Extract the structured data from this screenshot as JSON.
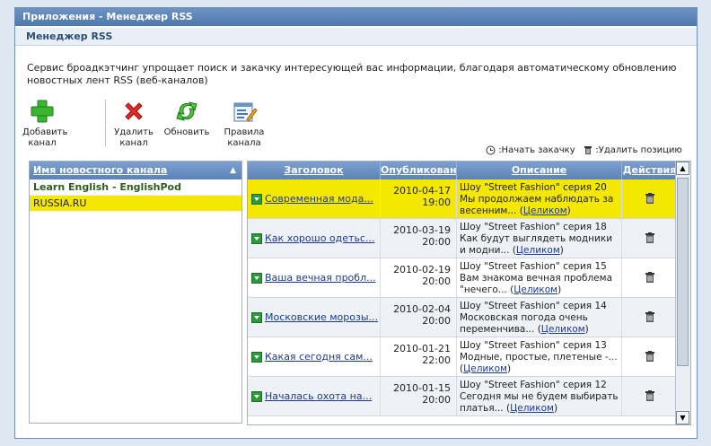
{
  "window": {
    "title": "Приложения - Менеджер RSS",
    "subheader": "Менеджер RSS",
    "description": "Сервис броадкэтчинг упрощает поиск и закачку интересующей вас информации, благодаря автоматическому обновлению новостных лент RSS (веб-каналов)"
  },
  "toolbar": {
    "add_line1": "Добавить",
    "add_line2": "канал",
    "delete_line1": "Удалить",
    "delete_line2": "канал",
    "refresh": "Обновить",
    "rules_line1": "Правила",
    "rules_line2": "канала"
  },
  "legend": {
    "start_download": ":Начать закачку",
    "delete_item": ":Удалить позицию"
  },
  "feeds": {
    "header": "Имя новостного канала",
    "items": [
      {
        "name": "Learn English - EnglishPod"
      },
      {
        "name": "RUSSIA.RU"
      }
    ]
  },
  "table": {
    "headers": [
      "Заголовок",
      "Опубликован",
      "Описание",
      "Действия"
    ],
    "rows": [
      {
        "title": "Современная мода...",
        "date": "2010-04-17",
        "time": "19:00",
        "desc": "Шоу \"Street Fashion\" серия 20 Мы продолжаем наблюдать за весенним...",
        "link": "Целиком"
      },
      {
        "title": "Как хорошо одетьс...",
        "date": "2010-03-19",
        "time": "20:00",
        "desc": "Шоу \"Street Fashion\" серия 18 Как будут выглядеть модники и модни...",
        "link": "Целиком"
      },
      {
        "title": "Ваша вечная пробл...",
        "date": "2010-02-19",
        "time": "20:00",
        "desc": "Шоу \"Street Fashion\" серия 15 Вам знакома вечная проблема \"нечего...",
        "link": "Целиком"
      },
      {
        "title": "Московские морозы...",
        "date": "2010-02-04",
        "time": "20:00",
        "desc": "Шоу \"Street Fashion\" серия 14 Московская погода очень переменчива...",
        "link": "Целиком"
      },
      {
        "title": "Какая сегодня сам...",
        "date": "2010-01-21",
        "time": "22:00",
        "desc": "Шоу \"Street Fashion\" серия 13 Модные, простые, плетеные -...",
        "link": "Целиком"
      },
      {
        "title": "Началась охота на...",
        "date": "2010-01-15",
        "time": "20:00",
        "desc": "Шоу \"Street Fashion\" серия 12 Сегодня мы не будем выбирать платья...",
        "link": "Целиком"
      }
    ]
  },
  "colors": {
    "selected": "#f4e700",
    "header_blue": "#5b82b8",
    "link": "#1b3a94"
  }
}
